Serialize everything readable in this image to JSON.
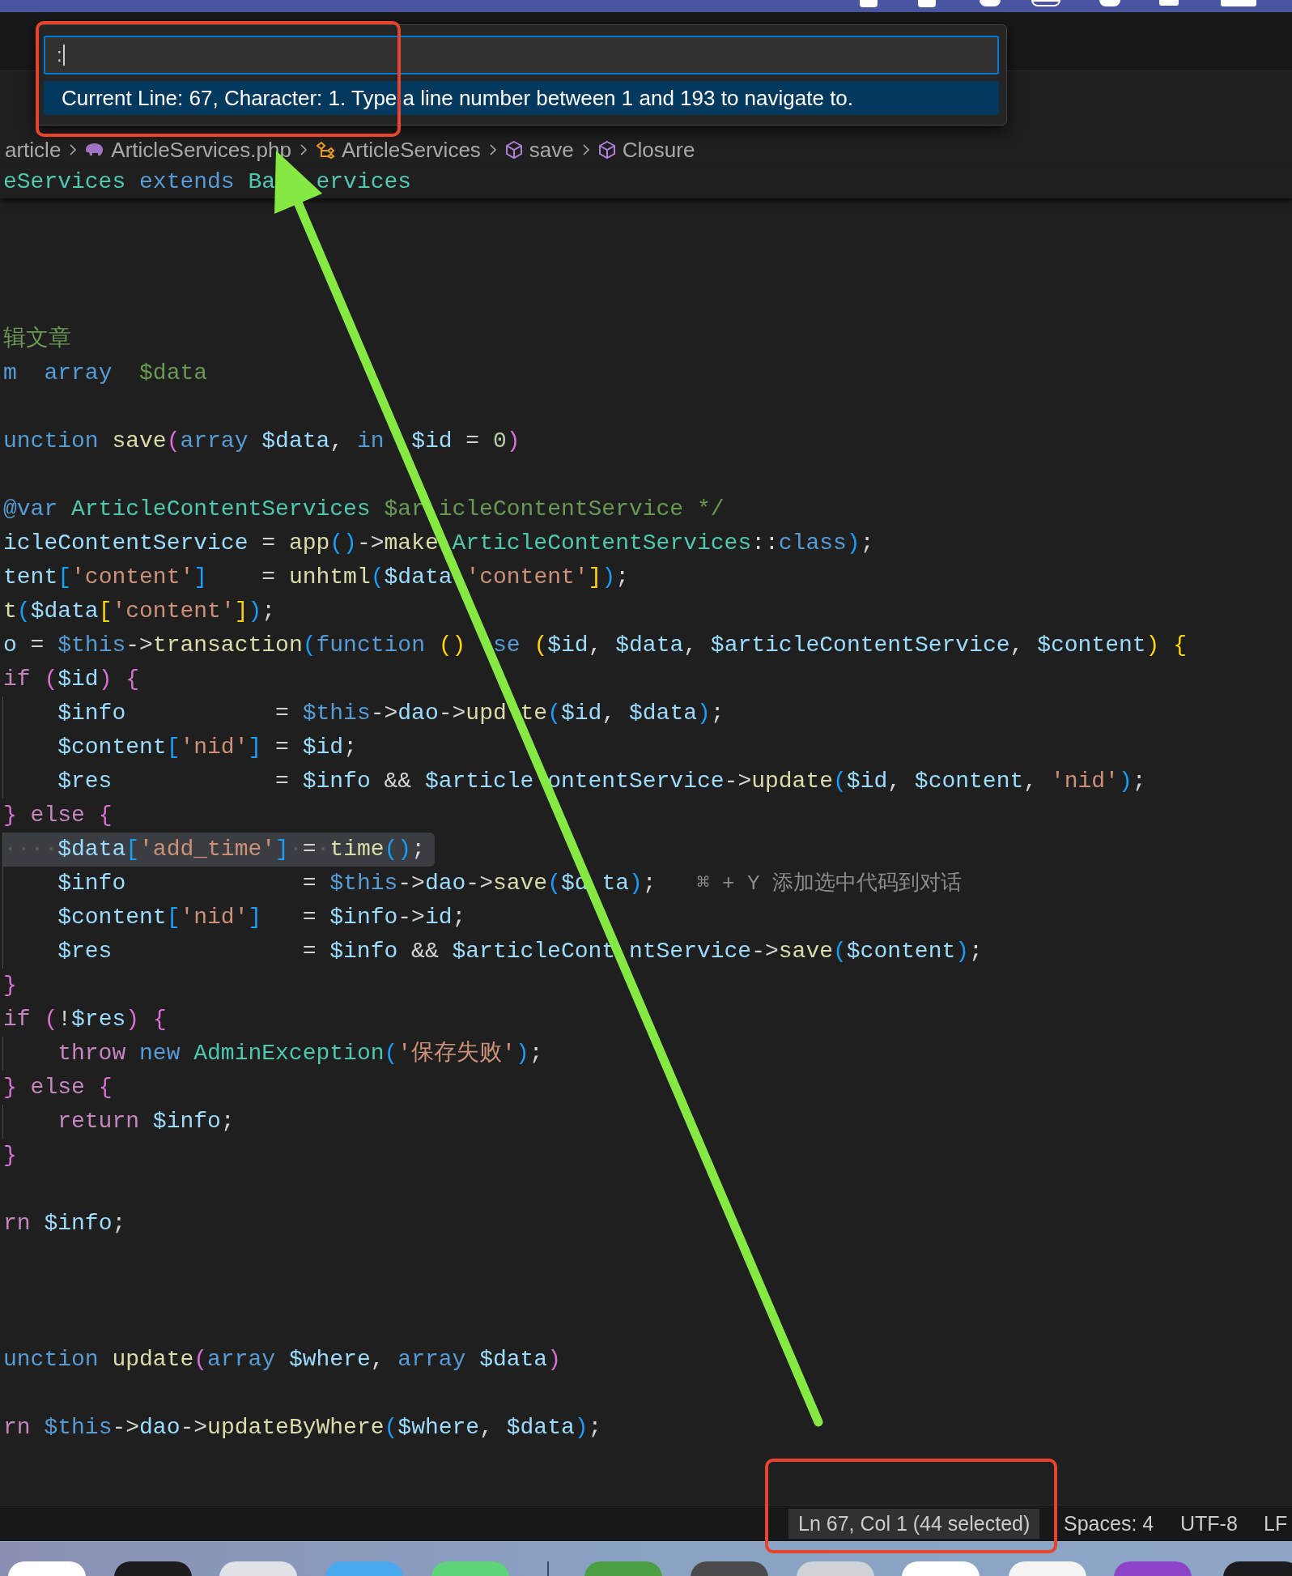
{
  "command_palette": {
    "value": ":",
    "hint": "Current Line: 67, Character: 1. Type a line number between 1 and 193 to navigate to."
  },
  "breadcrumb": [
    {
      "label": "article",
      "kind": "folder"
    },
    {
      "label": "ArticleServices.php",
      "kind": "php-file"
    },
    {
      "label": "ArticleServices",
      "kind": "class"
    },
    {
      "label": "save",
      "kind": "method"
    },
    {
      "label": "Closure",
      "kind": "method"
    }
  ],
  "sticky_line": [
    {
      "text": "eServices ",
      "kind": "type"
    },
    {
      "text": "extends ",
      "kind": "kw"
    },
    {
      "text": "Ba   ",
      "kind": "type"
    },
    {
      "text": "ervices",
      "kind": "type"
    }
  ],
  "lines": [
    {
      "kind": "blank"
    },
    {
      "kind": "blank"
    },
    {
      "kind": "blank"
    },
    {
      "kind": "code",
      "selected": false,
      "guide": false,
      "tokens": [
        {
          "text": "辑文章",
          "kind": "comment"
        }
      ]
    },
    {
      "kind": "code",
      "selected": false,
      "guide": false,
      "tokens": [
        {
          "text": "m  ",
          "kind": "kw"
        },
        {
          "text": "array  ",
          "kind": "kw"
        },
        {
          "text": "$data",
          "kind": "comment"
        }
      ]
    },
    {
      "kind": "blank"
    },
    {
      "kind": "code",
      "selected": false,
      "guide": false,
      "tokens": [
        {
          "text": "unction ",
          "kind": "kw"
        },
        {
          "text": "save",
          "kind": "fn"
        },
        {
          "text": "(",
          "kind": "br2"
        },
        {
          "text": "array ",
          "kind": "kw"
        },
        {
          "text": "$data",
          "kind": "var"
        },
        {
          "text": ", ",
          "kind": "punct"
        },
        {
          "text": "in  ",
          "kind": "kw"
        },
        {
          "text": "$id",
          "kind": "var"
        },
        {
          "text": " = ",
          "kind": "punct"
        },
        {
          "text": "0",
          "kind": "num"
        },
        {
          "text": ")",
          "kind": "br2"
        }
      ]
    },
    {
      "kind": "blank"
    },
    {
      "kind": "code",
      "selected": false,
      "guide": false,
      "tokens": [
        {
          "text": "@var ",
          "kind": "kw"
        },
        {
          "text": "ArticleContentServices ",
          "kind": "type"
        },
        {
          "text": "$ar ",
          "kind": "comment"
        },
        {
          "text": "icleContentService */",
          "kind": "comment"
        }
      ]
    },
    {
      "kind": "code",
      "selected": false,
      "guide": false,
      "tokens": [
        {
          "text": "icleContentService",
          "kind": "var"
        },
        {
          "text": " = ",
          "kind": "punct"
        },
        {
          "text": "app",
          "kind": "fn"
        },
        {
          "text": "()",
          "kind": "br3"
        },
        {
          "text": "->",
          "kind": "punct"
        },
        {
          "text": "make ",
          "kind": "fn"
        },
        {
          "text": "ArticleContentServices",
          "kind": "type"
        },
        {
          "text": "::",
          "kind": "punct"
        },
        {
          "text": "class",
          "kind": "kw"
        },
        {
          "text": ")",
          "kind": "br3"
        },
        {
          "text": ";",
          "kind": "punct"
        }
      ]
    },
    {
      "kind": "code",
      "selected": false,
      "guide": false,
      "tokens": [
        {
          "text": "tent",
          "kind": "var"
        },
        {
          "text": "[",
          "kind": "br3"
        },
        {
          "text": "'content'",
          "kind": "str"
        },
        {
          "text": "]",
          "kind": "br3"
        },
        {
          "text": "    = ",
          "kind": "punct"
        },
        {
          "text": "unhtml",
          "kind": "fn"
        },
        {
          "text": "(",
          "kind": "br3"
        },
        {
          "text": "$data ",
          "kind": "var"
        },
        {
          "text": "'content'",
          "kind": "str"
        },
        {
          "text": "]",
          "kind": "br1"
        },
        {
          "text": ")",
          "kind": "br3"
        },
        {
          "text": ";",
          "kind": "punct"
        }
      ]
    },
    {
      "kind": "code",
      "selected": false,
      "guide": false,
      "tokens": [
        {
          "text": "t",
          "kind": "fn"
        },
        {
          "text": "(",
          "kind": "br3"
        },
        {
          "text": "$data",
          "kind": "var"
        },
        {
          "text": "[",
          "kind": "br1"
        },
        {
          "text": "'content'",
          "kind": "str"
        },
        {
          "text": "]",
          "kind": "br1"
        },
        {
          "text": ")",
          "kind": "br3"
        },
        {
          "text": ";",
          "kind": "punct"
        }
      ]
    },
    {
      "kind": "code",
      "selected": false,
      "guide": false,
      "tokens": [
        {
          "text": "o",
          "kind": "var"
        },
        {
          "text": " = ",
          "kind": "punct"
        },
        {
          "text": "$this",
          "kind": "kw"
        },
        {
          "text": "->",
          "kind": "punct"
        },
        {
          "text": "transaction",
          "kind": "fn"
        },
        {
          "text": "(",
          "kind": "br3"
        },
        {
          "text": "function ",
          "kind": "kw"
        },
        {
          "text": "()  ",
          "kind": "br1"
        },
        {
          "text": "se ",
          "kind": "kw"
        },
        {
          "text": "(",
          "kind": "br1"
        },
        {
          "text": "$id",
          "kind": "var"
        },
        {
          "text": ", ",
          "kind": "punct"
        },
        {
          "text": "$data",
          "kind": "var"
        },
        {
          "text": ", ",
          "kind": "punct"
        },
        {
          "text": "$articleContentService",
          "kind": "var"
        },
        {
          "text": ", ",
          "kind": "punct"
        },
        {
          "text": "$content",
          "kind": "var"
        },
        {
          "text": ") ",
          "kind": "br1"
        },
        {
          "text": "{",
          "kind": "br1"
        }
      ]
    },
    {
      "kind": "code",
      "selected": false,
      "guide": false,
      "tokens": [
        {
          "text": "if ",
          "kind": "ctrl"
        },
        {
          "text": "(",
          "kind": "br2"
        },
        {
          "text": "$id",
          "kind": "var"
        },
        {
          "text": ") ",
          "kind": "br2"
        },
        {
          "text": "{",
          "kind": "br2"
        }
      ]
    },
    {
      "kind": "code",
      "selected": false,
      "guide": true,
      "tokens": [
        {
          "text": "    $info",
          "kind": "var"
        },
        {
          "text": "           = ",
          "kind": "punct"
        },
        {
          "text": "$this",
          "kind": "kw"
        },
        {
          "text": "->",
          "kind": "punct"
        },
        {
          "text": "dao",
          "kind": "var"
        },
        {
          "text": "->",
          "kind": "punct"
        },
        {
          "text": "upd ",
          "kind": "fn"
        },
        {
          "text": "te",
          "kind": "fn"
        },
        {
          "text": "(",
          "kind": "br3"
        },
        {
          "text": "$id",
          "kind": "var"
        },
        {
          "text": ", ",
          "kind": "punct"
        },
        {
          "text": "$data",
          "kind": "var"
        },
        {
          "text": ")",
          "kind": "br3"
        },
        {
          "text": ";",
          "kind": "punct"
        }
      ]
    },
    {
      "kind": "code",
      "selected": false,
      "guide": true,
      "tokens": [
        {
          "text": "    $content",
          "kind": "var"
        },
        {
          "text": "[",
          "kind": "br3"
        },
        {
          "text": "'nid'",
          "kind": "str"
        },
        {
          "text": "]",
          "kind": "br3"
        },
        {
          "text": " = ",
          "kind": "punct"
        },
        {
          "text": "$id",
          "kind": "var"
        },
        {
          "text": ";",
          "kind": "punct"
        }
      ]
    },
    {
      "kind": "code",
      "selected": false,
      "guide": true,
      "tokens": [
        {
          "text": "    $res",
          "kind": "var"
        },
        {
          "text": "            = ",
          "kind": "punct"
        },
        {
          "text": "$info",
          "kind": "var"
        },
        {
          "text": " && ",
          "kind": "punct"
        },
        {
          "text": "$article ",
          "kind": "var"
        },
        {
          "text": "ontentService",
          "kind": "var"
        },
        {
          "text": "->",
          "kind": "punct"
        },
        {
          "text": "update",
          "kind": "fn"
        },
        {
          "text": "(",
          "kind": "br3"
        },
        {
          "text": "$id",
          "kind": "var"
        },
        {
          "text": ", ",
          "kind": "punct"
        },
        {
          "text": "$content",
          "kind": "var"
        },
        {
          "text": ", ",
          "kind": "punct"
        },
        {
          "text": "'nid'",
          "kind": "str"
        },
        {
          "text": ")",
          "kind": "br3"
        },
        {
          "text": ";",
          "kind": "punct"
        }
      ]
    },
    {
      "kind": "code",
      "selected": false,
      "guide": false,
      "tokens": [
        {
          "text": "} ",
          "kind": "br2"
        },
        {
          "text": "else ",
          "kind": "ctrl"
        },
        {
          "text": "{",
          "kind": "br2"
        }
      ]
    },
    {
      "kind": "code",
      "selected": true,
      "guide": true,
      "tokens": [
        {
          "text": "····",
          "kind": "ws"
        },
        {
          "text": "$data",
          "kind": "var"
        },
        {
          "text": "[",
          "kind": "br3"
        },
        {
          "text": "'add_time'",
          "kind": "str"
        },
        {
          "text": "]",
          "kind": "br3"
        },
        {
          "text": "·",
          "kind": "ws"
        },
        {
          "text": "=",
          "kind": "punct"
        },
        {
          "text": "·",
          "kind": "ws"
        },
        {
          "text": "time",
          "kind": "fn"
        },
        {
          "text": "()",
          "kind": "br3"
        },
        {
          "text": ";",
          "kind": "punct"
        }
      ]
    },
    {
      "kind": "code",
      "selected": false,
      "guide": true,
      "hint": "⌘ + Y 添加选中代码到对话",
      "tokens": [
        {
          "text": "    $info",
          "kind": "var"
        },
        {
          "text": "             = ",
          "kind": "punct"
        },
        {
          "text": "$this",
          "kind": "kw"
        },
        {
          "text": "->",
          "kind": "punct"
        },
        {
          "text": "dao",
          "kind": "var"
        },
        {
          "text": "->",
          "kind": "punct"
        },
        {
          "text": "save",
          "kind": "fn"
        },
        {
          "text": "(",
          "kind": "br3"
        },
        {
          "text": "$d ",
          "kind": "var"
        },
        {
          "text": "ta",
          "kind": "var"
        },
        {
          "text": ")",
          "kind": "br3"
        },
        {
          "text": ";",
          "kind": "punct"
        }
      ]
    },
    {
      "kind": "code",
      "selected": false,
      "guide": true,
      "tokens": [
        {
          "text": "    $content",
          "kind": "var"
        },
        {
          "text": "[",
          "kind": "br3"
        },
        {
          "text": "'nid'",
          "kind": "str"
        },
        {
          "text": "]",
          "kind": "br3"
        },
        {
          "text": "   = ",
          "kind": "punct"
        },
        {
          "text": "$info",
          "kind": "var"
        },
        {
          "text": "->",
          "kind": "punct"
        },
        {
          "text": "id",
          "kind": "var"
        },
        {
          "text": ";",
          "kind": "punct"
        }
      ]
    },
    {
      "kind": "code",
      "selected": false,
      "guide": true,
      "tokens": [
        {
          "text": "    $res",
          "kind": "var"
        },
        {
          "text": "              = ",
          "kind": "punct"
        },
        {
          "text": "$info",
          "kind": "var"
        },
        {
          "text": " && ",
          "kind": "punct"
        },
        {
          "text": "$articleCont ",
          "kind": "var"
        },
        {
          "text": "ntService",
          "kind": "var"
        },
        {
          "text": "->",
          "kind": "punct"
        },
        {
          "text": "save",
          "kind": "fn"
        },
        {
          "text": "(",
          "kind": "br3"
        },
        {
          "text": "$content",
          "kind": "var"
        },
        {
          "text": ")",
          "kind": "br3"
        },
        {
          "text": ";",
          "kind": "punct"
        }
      ]
    },
    {
      "kind": "code",
      "selected": false,
      "guide": false,
      "tokens": [
        {
          "text": "}",
          "kind": "br2"
        }
      ]
    },
    {
      "kind": "code",
      "selected": false,
      "guide": false,
      "tokens": [
        {
          "text": "if ",
          "kind": "ctrl"
        },
        {
          "text": "(",
          "kind": "br2"
        },
        {
          "text": "!",
          "kind": "punct"
        },
        {
          "text": "$res",
          "kind": "var"
        },
        {
          "text": ") ",
          "kind": "br2"
        },
        {
          "text": "{",
          "kind": "br2"
        }
      ]
    },
    {
      "kind": "code",
      "selected": false,
      "guide": true,
      "tokens": [
        {
          "text": "    throw ",
          "kind": "ctrl"
        },
        {
          "text": "new ",
          "kind": "kw"
        },
        {
          "text": "AdminException",
          "kind": "type"
        },
        {
          "text": "(",
          "kind": "br3"
        },
        {
          "text": "'保存失败'",
          "kind": "str"
        },
        {
          "text": ")",
          "kind": "br3"
        },
        {
          "text": ";",
          "kind": "punct"
        }
      ]
    },
    {
      "kind": "code",
      "selected": false,
      "guide": false,
      "tokens": [
        {
          "text": "} ",
          "kind": "br2"
        },
        {
          "text": "else ",
          "kind": "ctrl"
        },
        {
          "text": "{",
          "kind": "br2"
        }
      ]
    },
    {
      "kind": "code",
      "selected": false,
      "guide": true,
      "tokens": [
        {
          "text": "    return ",
          "kind": "ctrl"
        },
        {
          "text": "$info",
          "kind": "var"
        },
        {
          "text": ";",
          "kind": "punct"
        }
      ]
    },
    {
      "kind": "code",
      "selected": false,
      "guide": false,
      "tokens": [
        {
          "text": "}",
          "kind": "br2"
        }
      ]
    },
    {
      "kind": "blank"
    },
    {
      "kind": "code",
      "selected": false,
      "guide": false,
      "tokens": [
        {
          "text": "rn ",
          "kind": "ctrl"
        },
        {
          "text": "$info",
          "kind": "var"
        },
        {
          "text": ";",
          "kind": "punct"
        }
      ]
    },
    {
      "kind": "blank"
    },
    {
      "kind": "blank"
    },
    {
      "kind": "blank"
    },
    {
      "kind": "code",
      "selected": false,
      "guide": false,
      "tokens": [
        {
          "text": "unction ",
          "kind": "kw"
        },
        {
          "text": "update",
          "kind": "fn"
        },
        {
          "text": "(",
          "kind": "br2"
        },
        {
          "text": "array ",
          "kind": "kw"
        },
        {
          "text": "$where",
          "kind": "var"
        },
        {
          "text": ", ",
          "kind": "punct"
        },
        {
          "text": "array ",
          "kind": "kw"
        },
        {
          "text": "$data",
          "kind": "var"
        },
        {
          "text": ")",
          "kind": "br2"
        }
      ]
    },
    {
      "kind": "blank"
    },
    {
      "kind": "code",
      "selected": false,
      "guide": false,
      "tokens": [
        {
          "text": "rn ",
          "kind": "ctrl"
        },
        {
          "text": "$this",
          "kind": "kw"
        },
        {
          "text": "->",
          "kind": "punct"
        },
        {
          "text": "dao",
          "kind": "var"
        },
        {
          "text": "->",
          "kind": "punct"
        },
        {
          "text": "updateByWhere",
          "kind": "fn"
        },
        {
          "text": "(",
          "kind": "br3"
        },
        {
          "text": "$where",
          "kind": "var"
        },
        {
          "text": ", ",
          "kind": "punct"
        },
        {
          "text": "$data",
          "kind": "var"
        },
        {
          "text": ")",
          "kind": "br3"
        },
        {
          "text": ";",
          "kind": "punct"
        }
      ]
    }
  ],
  "status_bar": [
    {
      "label": "Ln 67, Col 1 (44 selected)",
      "selected": true
    },
    {
      "label": "Spaces: 4",
      "selected": false
    },
    {
      "label": "UTF-8",
      "selected": false
    },
    {
      "label": "LF",
      "selected": false
    }
  ],
  "dock": [
    {
      "kind": "app",
      "color": "#ffffff"
    },
    {
      "kind": "app",
      "color": "#1c1c1e"
    },
    {
      "kind": "app",
      "color": "#dfe3e8"
    },
    {
      "kind": "app",
      "color": "#4aa8ee"
    },
    {
      "kind": "app",
      "color": "#5fd37a"
    },
    {
      "kind": "separator"
    },
    {
      "kind": "app",
      "color": "#4c9e45"
    },
    {
      "kind": "app",
      "color": "#4a4a4c"
    },
    {
      "kind": "app",
      "color": "#cfd2d6"
    },
    {
      "kind": "app",
      "color": "#ffffff"
    },
    {
      "kind": "app",
      "color": "#f4f4f4"
    },
    {
      "kind": "app",
      "color": "#8e44c8"
    },
    {
      "kind": "app",
      "color": "#1c1c1e"
    }
  ]
}
